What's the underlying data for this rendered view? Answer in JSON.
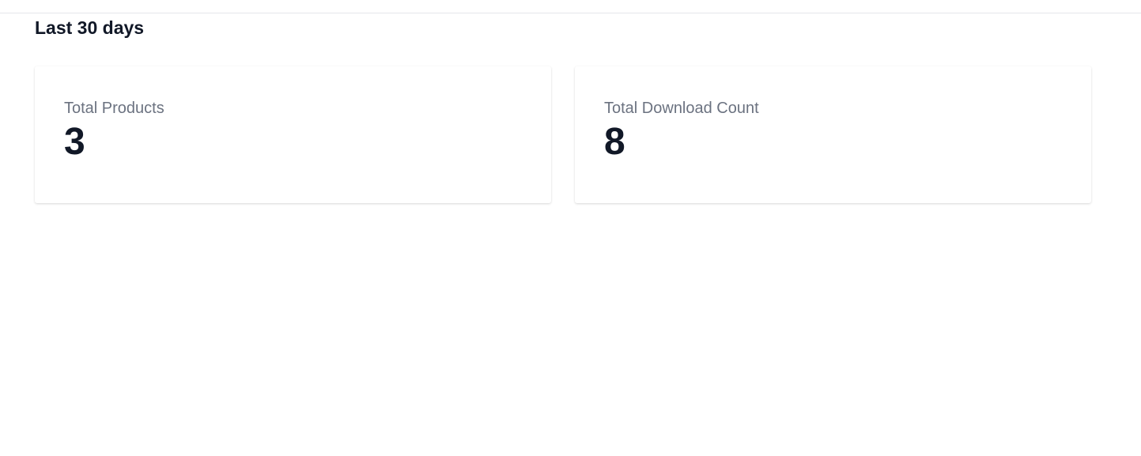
{
  "header": {
    "title": "Last 30 days"
  },
  "stats": [
    {
      "label": "Total Products",
      "value": "3"
    },
    {
      "label": "Total Download Count",
      "value": "8"
    }
  ],
  "colors": {
    "text_primary": "#111827",
    "text_secondary": "#6b7280",
    "divider": "#e5e7eb",
    "card_bg": "#ffffff"
  }
}
